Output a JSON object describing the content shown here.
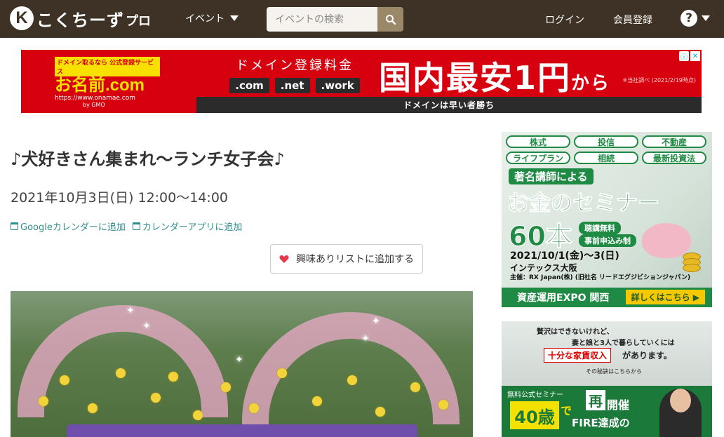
{
  "header": {
    "logo_mark": "K",
    "logo_text": "こくちーず",
    "logo_pro": "プロ",
    "nav_event": "イベント",
    "search_placeholder": "イベントの検索",
    "login": "ログイン",
    "register": "会員登録",
    "help": "?"
  },
  "banner_ad": {
    "left_top": "ドメイン取るなら 公式登録サービス",
    "left_logo": "お名前.com",
    "left_url": "https://www.onamae.com",
    "left_gmo": "by GMO",
    "mid_title": "ドメイン登録料金",
    "tlds": [
      ".com",
      ".net",
      ".work"
    ],
    "big_text": "国内最安",
    "big_price": "1円",
    "big_from": "から",
    "note": "※当社調べ (2021/2/19時点)",
    "bottom": "ドメインは早い者勝ち"
  },
  "event": {
    "title": "♪犬好きさん集まれ〜ランチ女子会♪",
    "datetime": "2021年10月3日(日) 12:00〜14:00",
    "google_calendar": "Googleカレンダーに追加",
    "calendar_app": "カレンダーアプリに追加",
    "interest_button": "興味ありリストに追加する"
  },
  "side_ad1": {
    "pills_row1": [
      "株式",
      "投信",
      "不動産"
    ],
    "pills_row2": [
      "ライフプラン",
      "相続",
      "最新投資法"
    ],
    "subtitle": "著名講師による",
    "main": "お金のセミナー",
    "count": "60本",
    "tag1": "聴講無料",
    "tag2": "事前申込み制",
    "date": "2021/10/1(金)〜3(日)",
    "place": "インテックス大阪",
    "host": "主催：RX Japan(株) (旧社名 リードエグジビションジャパン)",
    "footer": "資産運用EXPO 関西",
    "detail": "詳しくはこちら ▶"
  },
  "side_ad2": {
    "line1": "贅沢はできないけれど、",
    "line2": "妻と娘と3人で暮らしていくには",
    "highlight": "十分な家賃収入",
    "after": "があります。",
    "small": "その秘訣はこちらから",
    "free": "無料公式セミナー",
    "age": "40歳",
    "de": "で",
    "sai": "再",
    "kaisai": "開催",
    "fire": "FIRE達成の"
  },
  "colors": {
    "header_bg": "#3d3225",
    "accent_teal": "#2f8e8e",
    "banner_red": "#d7000f",
    "ad_green": "#1f8a43"
  }
}
